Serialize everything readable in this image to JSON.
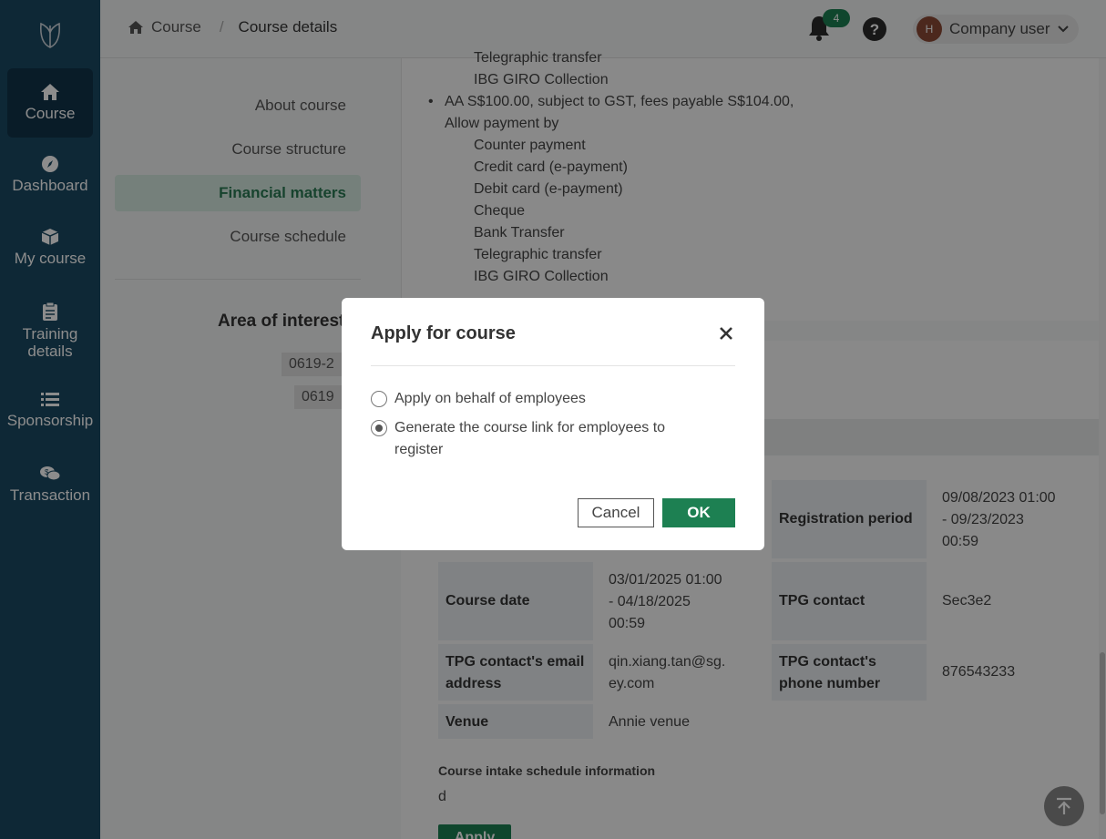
{
  "sidebar": {
    "items": [
      {
        "label": "Course",
        "icon": "home-icon"
      },
      {
        "label": "Dashboard",
        "icon": "compass-icon"
      },
      {
        "label": "My course",
        "icon": "box-icon"
      },
      {
        "label": "Training details",
        "icon": "clipboard-icon"
      },
      {
        "label": "Sponsorship",
        "icon": "list-icon"
      },
      {
        "label": "Transaction",
        "icon": "chat-money-icon"
      }
    ]
  },
  "header": {
    "breadcrumb": [
      "Course",
      "/",
      "Course details"
    ],
    "notifications": "4",
    "user_initial": "H",
    "user_name": "Company user"
  },
  "leftmenu": {
    "items": [
      "About course",
      "Course structure",
      "Financial matters",
      "Course schedule"
    ],
    "area_title": "Area of interest",
    "tags": [
      "0619-2",
      "0619"
    ]
  },
  "financial": {
    "top_lines": [
      "Telegraphic transfer",
      "IBG GIRO Collection"
    ],
    "bullet": "AA S$100.00, subject to GST, fees payable S$104.00,",
    "allow": "Allow payment by",
    "methods": [
      "Counter payment",
      "Credit card (e-payment)",
      "Debit card (e-payment)",
      "Cheque",
      "Bank Transfer",
      "Telegraphic transfer",
      "IBG GIRO Collection"
    ]
  },
  "details": {
    "reg_label": "Registration period",
    "reg_value": "09/08/2023 01:00 - 09/23/2023 00:59",
    "date_label": "Course date",
    "date_value": "03/01/2025 01:00 - 04/18/2025 00:59",
    "tpg_label": "TPG contact",
    "tpg_value": "Sec3e2",
    "email_label": "TPG contact's email address",
    "email_value": "qin.xiang.tan@sg.ey.com",
    "phone_label": "TPG contact's phone number",
    "phone_value": "876543233",
    "venue_label": "Venue",
    "venue_value": "Annie venue",
    "intake_title": "Course intake schedule information",
    "intake_value": "d",
    "apply": "Apply"
  },
  "modal": {
    "title": "Apply for course",
    "option1": "Apply on behalf of employees",
    "option2": "Generate the course link for employees to register",
    "cancel": "Cancel",
    "ok": "OK"
  },
  "colors": {
    "sidebar": "#1b4a63",
    "accent": "#1d8052"
  }
}
